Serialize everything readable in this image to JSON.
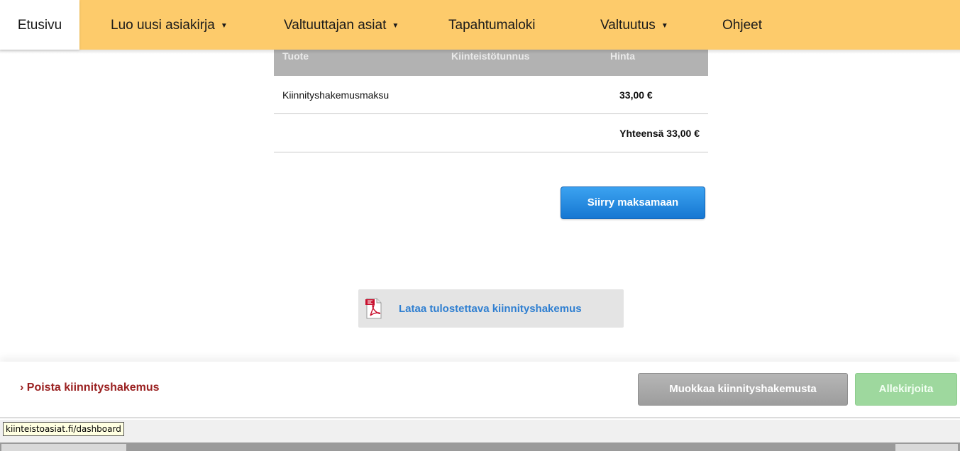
{
  "nav": {
    "items": [
      {
        "label": "Etusivu",
        "caret": false,
        "active": true
      },
      {
        "label": "Luo uusi asiakirja",
        "caret": true
      },
      {
        "label": "Valtuuttajan asiat",
        "caret": true
      },
      {
        "label": "Tapahtumaloki",
        "caret": false
      },
      {
        "label": "Valtuutus",
        "caret": true
      },
      {
        "label": "Ohjeet",
        "caret": false
      }
    ],
    "caret_glyph": "▼"
  },
  "table": {
    "headers": [
      "Tuote",
      "Kiinteistötunnus",
      "Hinta"
    ],
    "rows": [
      {
        "product": "Kiinnityshakemusmaksu",
        "property_id": "",
        "price": "33,00 €"
      }
    ],
    "total": "Yhteensä 33,00 €"
  },
  "actions": {
    "pay_label": "Siirry maksamaan",
    "download_label": "Lataa tulostettava kiinnityshakemus",
    "delete_label": "› Poista kiinnityshakemus",
    "edit_label": "Muokkaa kiinnityshakemusta",
    "sign_label": "Allekirjoita"
  },
  "status_bar": {
    "url": "kiinteistoasiat.fi/dashboard"
  },
  "colors": {
    "nav_bg": "#fdcb6b",
    "primary_button": "#1e88e5",
    "delete_link": "#9a2121",
    "sign_button": "#9ed89e"
  }
}
